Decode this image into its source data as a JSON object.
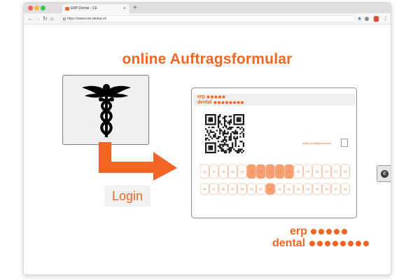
{
  "browser": {
    "tab_title": "ERP-Dental - CE",
    "tab_close": "×",
    "new_tab": "+",
    "url": "https://www.erp-dental.ch",
    "nav": {
      "back": "←",
      "forward": "→",
      "reload": "↻",
      "home": "⌂"
    },
    "star": "★",
    "menu": "⋮"
  },
  "page": {
    "title": "online Auftragsformular",
    "login_label": "Login",
    "phone_glyph": "✆"
  },
  "form_card": {
    "logo_line1": "erp",
    "logo_line2": "dental",
    "link_text": "online Auftragsformular",
    "upper_teeth": [
      "18",
      "17",
      "16",
      "15",
      "14",
      "13",
      "12",
      "11",
      "21",
      "22",
      "23",
      "24",
      "25",
      "26",
      "27",
      "28"
    ],
    "lower_teeth": [
      "48",
      "47",
      "46",
      "45",
      "44",
      "43",
      "42",
      "41",
      "31",
      "32",
      "33",
      "34",
      "35",
      "36",
      "37",
      "38"
    ]
  },
  "brand": {
    "line1": "erp",
    "line2": "dental"
  },
  "colors": {
    "accent": "#f26522"
  }
}
